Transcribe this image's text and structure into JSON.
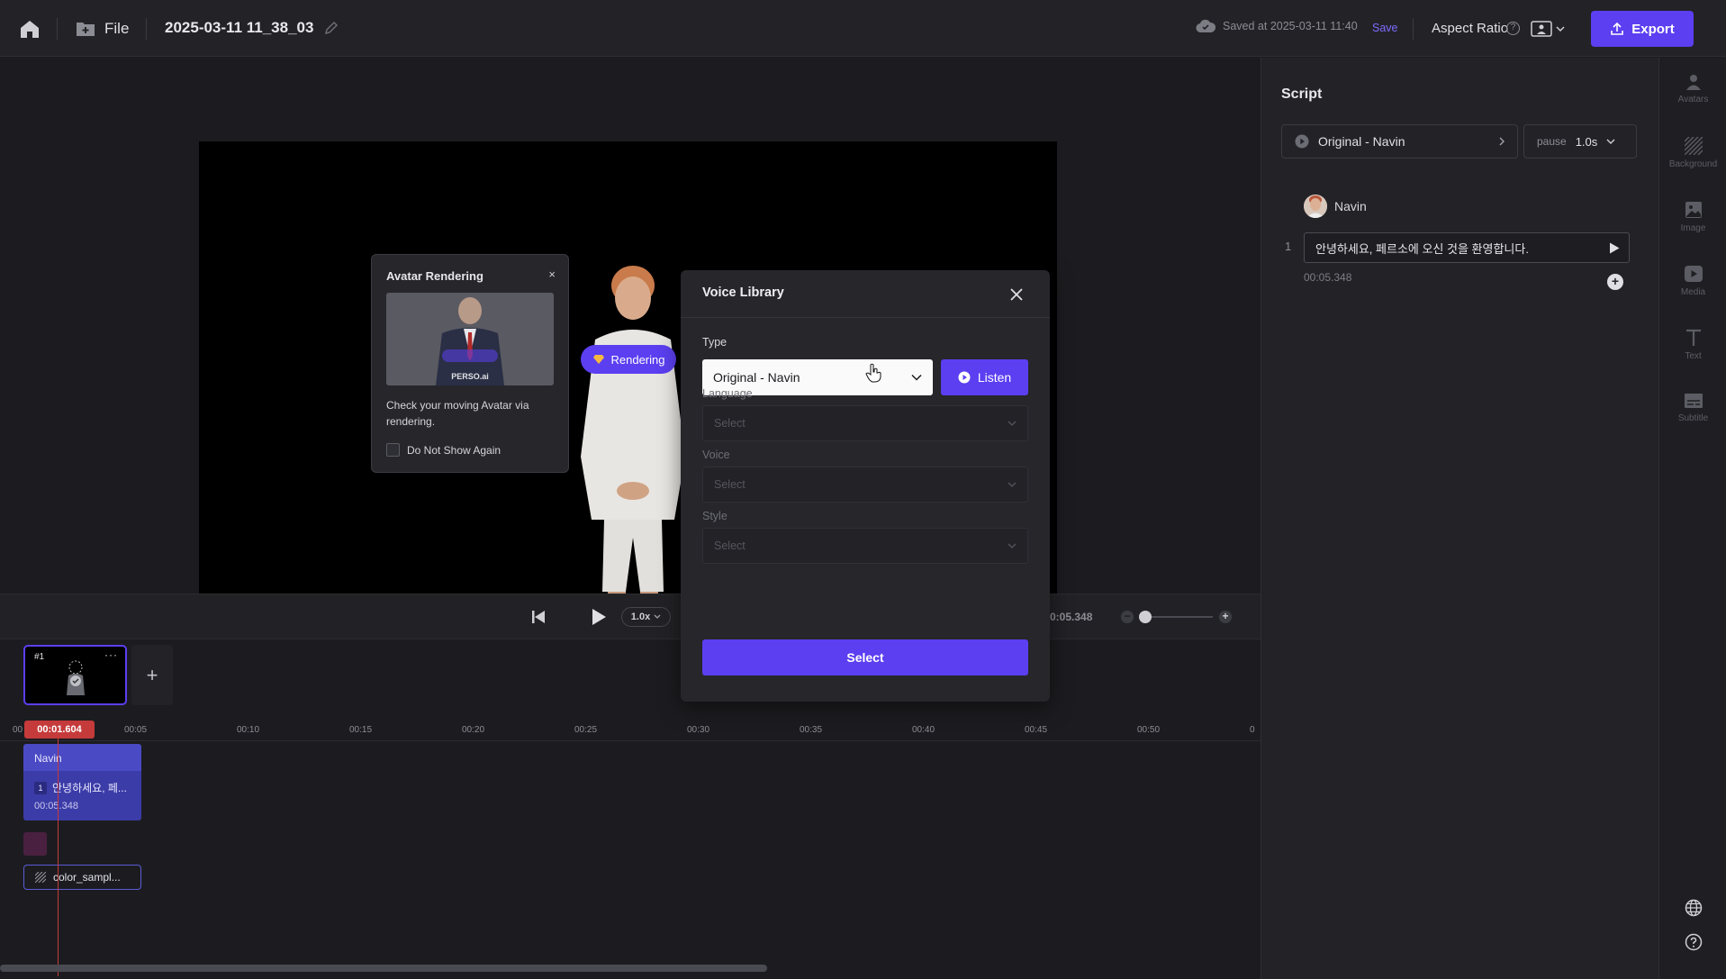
{
  "topbar": {
    "file_label": "File",
    "project_title": "2025-03-11 11_38_03",
    "saved_text": "Saved at 2025-03-11 11:40",
    "save_label": "Save",
    "aspect_ratio_label": "Aspect Ratio",
    "help_glyph": "?",
    "export_label": "Export"
  },
  "canvas": {
    "rendering_label": "Rendering"
  },
  "popover": {
    "title": "Avatar Rendering",
    "close_glyph": "×",
    "thumb_caption": "PERSO.ai",
    "message": "Check your moving Avatar via rendering.",
    "checkbox_label": "Do Not Show Again"
  },
  "playback": {
    "speed": "1.0x",
    "end_time": "0:05.348",
    "zoom_minus": "−",
    "zoom_plus": "+"
  },
  "timeline": {
    "scene_number": "#1",
    "scene_more": "···",
    "add_scene": "+",
    "playhead_time": "00:01.604",
    "ticks": [
      "00",
      "00:05",
      "00:10",
      "00:15",
      "00:20",
      "00:25",
      "00:30",
      "00:35",
      "00:40",
      "00:45",
      "00:50",
      "0"
    ],
    "track_name": "Navin",
    "clip_index": "1",
    "clip_text": "안녕하세요, 페...",
    "clip_time": "00:05.348",
    "bg_clip_label": "color_sampl..."
  },
  "modal": {
    "title": "Voice Library",
    "type_label": "Type",
    "type_value": "Original - Navin",
    "listen_label": "Listen",
    "language_label": "Language",
    "language_placeholder": "Select",
    "voice_label": "Voice",
    "voice_placeholder": "Select",
    "style_label": "Style",
    "style_placeholder": "Select",
    "select_button": "Select"
  },
  "script": {
    "title": "Script",
    "voice_value": "Original - Navin",
    "pause_label": "pause",
    "pause_value": "1.0s",
    "speaker": "Navin",
    "line_number": "1",
    "line_text": "안녕하세요, 페르소에 오신 것을 환영합니다.",
    "line_time": "00:05.348",
    "add_glyph": "+"
  },
  "rail": {
    "items": [
      {
        "label": "Avatars",
        "icon": "person-icon"
      },
      {
        "label": "Background",
        "icon": "hatch-icon"
      },
      {
        "label": "Image",
        "icon": "image-icon"
      },
      {
        "label": "Media",
        "icon": "play-icon"
      },
      {
        "label": "Text",
        "icon": "text-icon"
      },
      {
        "label": "Subtitle",
        "icon": "subtitle-icon"
      }
    ]
  },
  "colors": {
    "accent": "#5b3ff0",
    "playhead": "#c53a3a",
    "background": "#1c1c20"
  }
}
